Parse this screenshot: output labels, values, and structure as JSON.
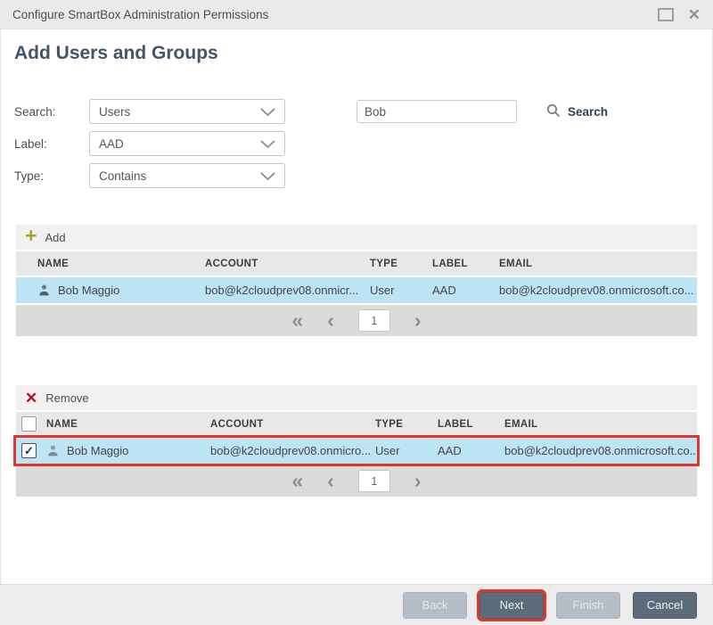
{
  "window": {
    "title": "Configure SmartBox Administration Permissions"
  },
  "icons": {
    "close": "✕",
    "add_plus": "+",
    "remove_x": "✕",
    "check": "✓",
    "page_first": "«",
    "page_prev": "‹",
    "page_next": "›"
  },
  "heading": "Add Users and Groups",
  "form": {
    "search_row": {
      "label": "Search:",
      "dropdown_value": "Users"
    },
    "label_row": {
      "label": "Label:",
      "dropdown_value": "AAD"
    },
    "type_row": {
      "label": "Type:",
      "dropdown_value": "Contains"
    },
    "search_input": {
      "value": "Bob"
    },
    "search_button_label": "Search"
  },
  "add_section": {
    "toolbar_label": "Add",
    "columns": [
      "NAME",
      "ACCOUNT",
      "TYPE",
      "LABEL",
      "EMAIL"
    ],
    "row": {
      "name": "Bob Maggio",
      "account": "bob@k2cloudprev08.onmicr...",
      "type": "User",
      "label": "AAD",
      "email": "bob@k2cloudprev08.onmicrosoft.co..."
    },
    "page": "1"
  },
  "remove_section": {
    "toolbar_label": "Remove",
    "columns": [
      "NAME",
      "ACCOUNT",
      "TYPE",
      "LABEL",
      "EMAIL"
    ],
    "row": {
      "checked": true,
      "name": "Bob Maggio",
      "account": "bob@k2cloudprev08.onmicro...",
      "type": "User",
      "label": "AAD",
      "email": "bob@k2cloudprev08.onmicrosoft.co..."
    },
    "page": "1"
  },
  "footer": {
    "back": "Back",
    "next": "Next",
    "finish": "Finish",
    "cancel": "Cancel"
  },
  "colors": {
    "selection_blue": "#bde4f4",
    "annotation_red": "#e0352b",
    "add_plus_green": "#a6a32b",
    "remove_x_red": "#b0121a",
    "button_dark": "#5d6b7a",
    "button_light": "#b5bdc7",
    "heading_text": "#44546a"
  }
}
